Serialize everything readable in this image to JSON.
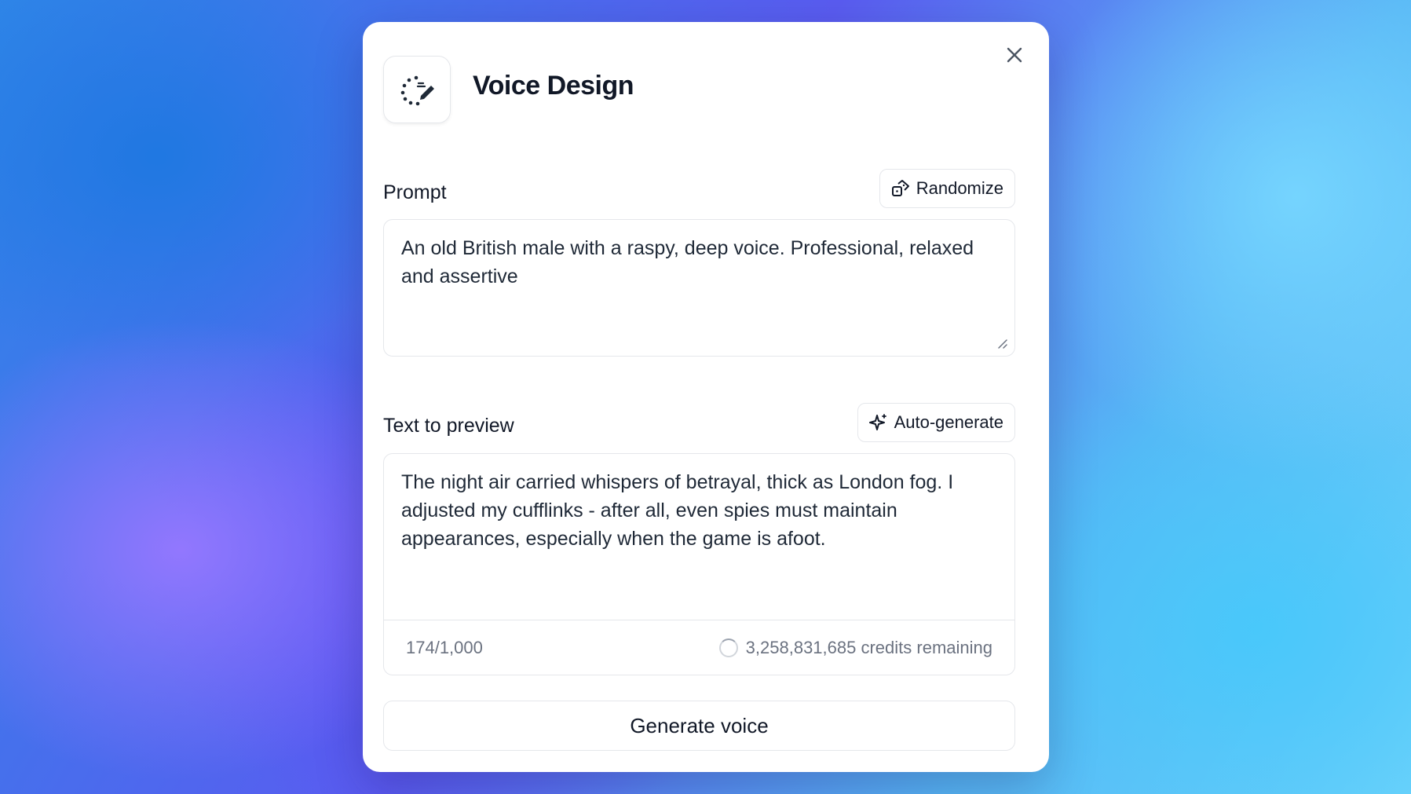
{
  "dialog": {
    "title": "Voice Design",
    "header_icon": "voice-design-icon",
    "close_icon": "close-icon"
  },
  "prompt": {
    "label": "Prompt",
    "randomize_label": "Randomize",
    "randomize_icon": "dice-icon",
    "value": "An old British male with a raspy, deep voice. Professional, relaxed and assertive"
  },
  "preview": {
    "label": "Text to preview",
    "autogenerate_label": "Auto-generate",
    "autogenerate_icon": "sparkle-icon",
    "value": "The night air carried whispers of betrayal, thick as London fog. I adjusted my cufflinks - after all, even spies must maintain appearances, especially when the game is afoot.",
    "char_count": "174/1,000",
    "credits": "3,258,831,685 credits remaining"
  },
  "actions": {
    "generate_label": "Generate voice"
  }
}
